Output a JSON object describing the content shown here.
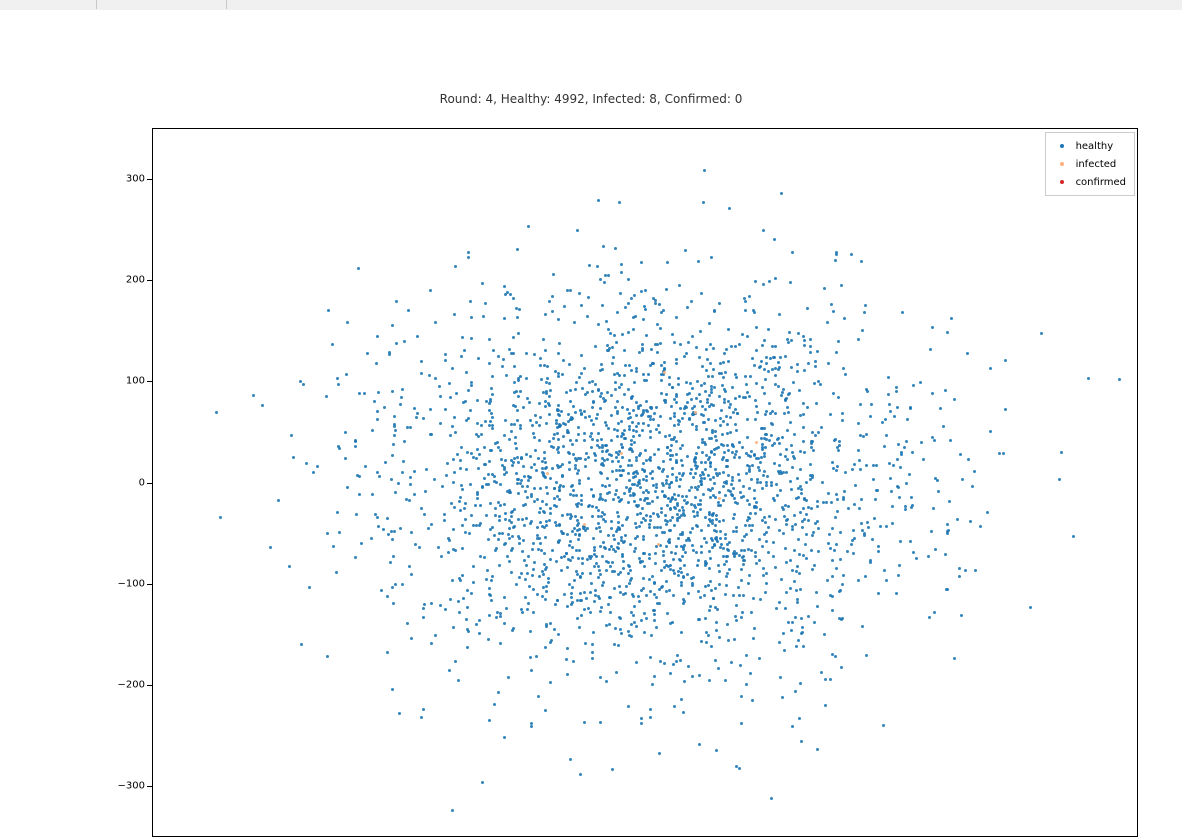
{
  "chart_data": {
    "type": "scatter",
    "title": "Round: 4, Healthy: 4992, Infected: 8, Confirmed: 0",
    "xlabel": "",
    "ylabel": "",
    "xlim": [
      -400,
      400
    ],
    "ylim": [
      -350,
      350
    ],
    "y_ticks": [
      -300,
      -200,
      -100,
      0,
      100,
      200,
      300
    ],
    "series": [
      {
        "name": "healthy",
        "color": "#1f77b4",
        "distribution": "normal",
        "n": 4992,
        "mu_x": 0,
        "mu_y": 0,
        "sigma_x": 110,
        "sigma_y": 95,
        "note": "points approximate a 2D Gaussian cloud centered near origin"
      },
      {
        "name": "infected",
        "color": "#ffb07a",
        "n": 8,
        "points": [
          [
            40,
            70
          ],
          [
            -20,
            30
          ],
          [
            60,
            -15
          ],
          [
            -50,
            -40
          ],
          [
            15,
            110
          ],
          [
            -80,
            10
          ],
          [
            90,
            40
          ],
          [
            10,
            -60
          ]
        ]
      },
      {
        "name": "confirmed",
        "color": "#d62728",
        "n": 0,
        "points": []
      }
    ],
    "legend": {
      "position": "upper right",
      "entries": [
        "healthy",
        "infected",
        "confirmed"
      ]
    }
  },
  "title": "Round: 4, Healthy: 4992, Infected: 8, Confirmed: 0",
  "legend": {
    "healthy": "healthy",
    "infected": "infected",
    "confirmed": "confirmed"
  },
  "yticks": {
    "t300": "300",
    "t200": "200",
    "t100": "100",
    "t0": "0",
    "tm100": "−100",
    "tm200": "−200",
    "tm300": "−300"
  }
}
